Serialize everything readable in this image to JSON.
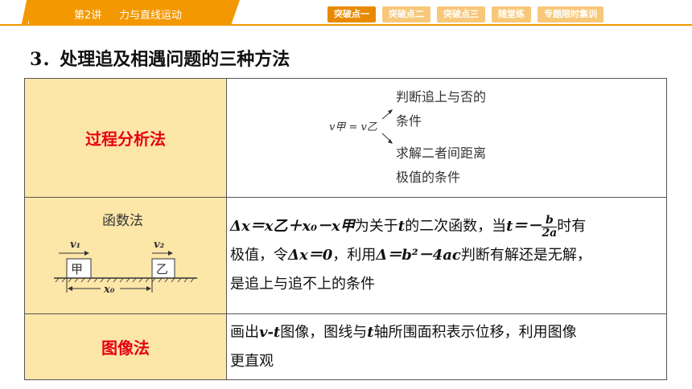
{
  "header": {
    "lesson": "第2讲",
    "topic": "力与直线运动",
    "tabs": [
      {
        "label": "突破点一",
        "active": true
      },
      {
        "label": "突破点二",
        "active": false
      },
      {
        "label": "突破点三",
        "active": false
      },
      {
        "label": "随堂练",
        "active": false
      },
      {
        "label": "专题限时集训",
        "active": false
      }
    ]
  },
  "title": "3．处理追及相遇问题的三种方法",
  "rows": {
    "process": {
      "label": "过程分析法",
      "equation": "v甲 = v乙",
      "branch_up_1": "判断追上与否的",
      "branch_up_2": "条件",
      "branch_down_1": "求解二者间距离",
      "branch_down_2": "极值的条件"
    },
    "function": {
      "label": "函数法",
      "v1": "v₁",
      "v2": "v₂",
      "box1": "甲",
      "box2": "乙",
      "x0": "x₀",
      "text_line1_a": "Δx＝x乙＋x₀－x甲",
      "text_line1_b": "为关于",
      "text_line1_t": "t",
      "text_line1_c": "的二次函数，当",
      "text_line1_d": "t＝－",
      "frac_num": "b",
      "frac_den": "2a",
      "text_line1_e": "时有",
      "text_line2_a": "极值，令",
      "text_line2_b": "Δx＝0",
      "text_line2_c": "，利用",
      "text_line2_d": "Δ＝b²－4ac",
      "text_line2_e": "判断有解还是无解，",
      "text_line3": "是追上与追不上的条件"
    },
    "graph": {
      "label": "图像法",
      "text_a": "画出",
      "text_b": "v-t",
      "text_c": "图像，图线与",
      "text_d": "t",
      "text_e": "轴所围面积表示位移，利用图像",
      "text_line2": "更直观"
    }
  }
}
